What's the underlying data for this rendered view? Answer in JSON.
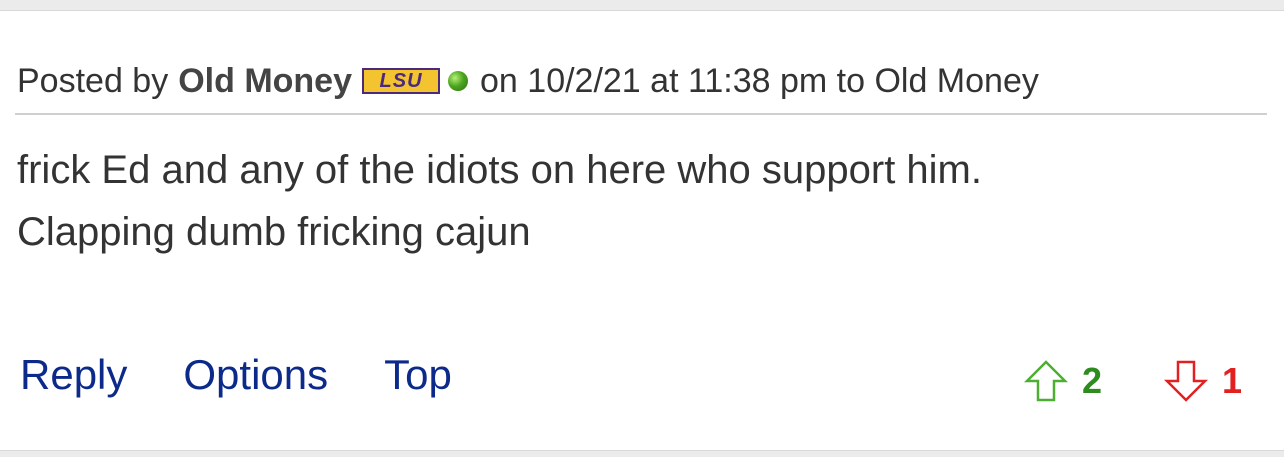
{
  "post": {
    "posted_by_label": "Posted by",
    "author": "Old Money",
    "team_logo_text": "LSU",
    "meta": "on 10/2/21 at 11:38 pm to Old Money",
    "body_line1": "frick Ed and any of the idiots on here who support him.",
    "body_line2": "Clapping dumb fricking cajun"
  },
  "actions": {
    "reply": "Reply",
    "options": "Options",
    "top": "Top"
  },
  "votes": {
    "up_count": "2",
    "down_count": "1",
    "up_color": "#2e8b1e",
    "down_color": "#e32020"
  },
  "colors": {
    "link": "#0b2a8a",
    "text": "#333333",
    "divider": "#cfcfcf"
  }
}
